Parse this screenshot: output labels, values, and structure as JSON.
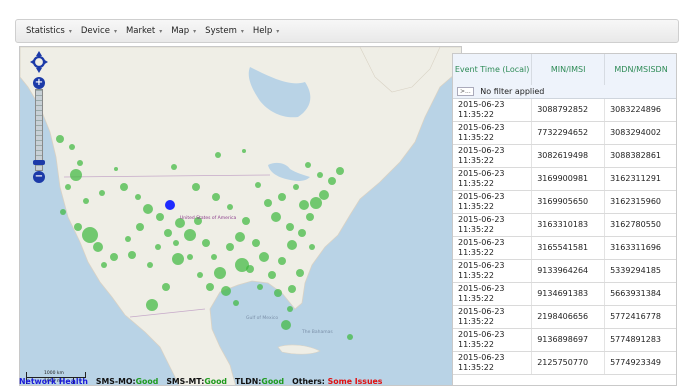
{
  "menu": {
    "items": [
      {
        "label": "Statistics"
      },
      {
        "label": "Device"
      },
      {
        "label": "Market"
      },
      {
        "label": "Map"
      },
      {
        "label": "System"
      },
      {
        "label": "Help"
      }
    ],
    "caret": "▾"
  },
  "map": {
    "water_color": "#b9d3e6",
    "land_color": "#efeee6",
    "marker_color": "#3cb83c",
    "selected_marker_color": "#1f2bff",
    "labels": {
      "country_center": "United States of America",
      "gulf": "Gulf of Mexico",
      "bahamas": "The Bahamas"
    },
    "scale": {
      "top": "1000 km",
      "bottom": "1000 mi"
    },
    "zoom": {
      "plus": "+",
      "minus": "−"
    }
  },
  "table": {
    "headers": {
      "event_time": "Event Time (Local)",
      "min_imsi": "MIN/IMSI",
      "mdn_msisdn": "MDN/MSISDN"
    },
    "filter_button": ">...",
    "filter_text": "No filter applied",
    "rows": [
      {
        "date": "2015-06-23",
        "time": "11:35:22",
        "min": "3088792852",
        "mdn": "3083224896"
      },
      {
        "date": "2015-06-23",
        "time": "11:35:22",
        "min": "7732294652",
        "mdn": "3083294002"
      },
      {
        "date": "2015-06-23",
        "time": "11:35:22",
        "min": "3082619498",
        "mdn": "3088382861"
      },
      {
        "date": "2015-06-23",
        "time": "11:35:22",
        "min": "3169900981",
        "mdn": "3162311291"
      },
      {
        "date": "2015-06-23",
        "time": "11:35:22",
        "min": "3169905650",
        "mdn": "3162315960"
      },
      {
        "date": "2015-06-23",
        "time": "11:35:22",
        "min": "3163310183",
        "mdn": "3162780550"
      },
      {
        "date": "2015-06-23",
        "time": "11:35:22",
        "min": "3165541581",
        "mdn": "3163311696"
      },
      {
        "date": "2015-06-23",
        "time": "11:35:22",
        "min": "9133964264",
        "mdn": "5339294185"
      },
      {
        "date": "2015-06-23",
        "time": "11:35:22",
        "min": "9134691383",
        "mdn": "5663931384"
      },
      {
        "date": "2015-06-23",
        "time": "11:35:22",
        "min": "2198406656",
        "mdn": "5772416778"
      },
      {
        "date": "2015-06-23",
        "time": "11:35:22",
        "min": "9136898697",
        "mdn": "5774891283"
      },
      {
        "date": "2015-06-23",
        "time": "11:35:22",
        "min": "2125750770",
        "mdn": "5774923349"
      }
    ]
  },
  "status": {
    "network_health": "Network Health",
    "sms_mo_label": "SMS-MO:",
    "sms_mo_value": "Good",
    "sms_mt_label": "SMS-MT:",
    "sms_mt_value": "Good",
    "tldn_label": "TLDN:",
    "tldn_value": "Good",
    "others_label": "Others:",
    "others_value": "Some Issues",
    "colors": {
      "good": "#1e9a1e",
      "issue": "#e01010",
      "link": "#1b1bd8"
    }
  }
}
